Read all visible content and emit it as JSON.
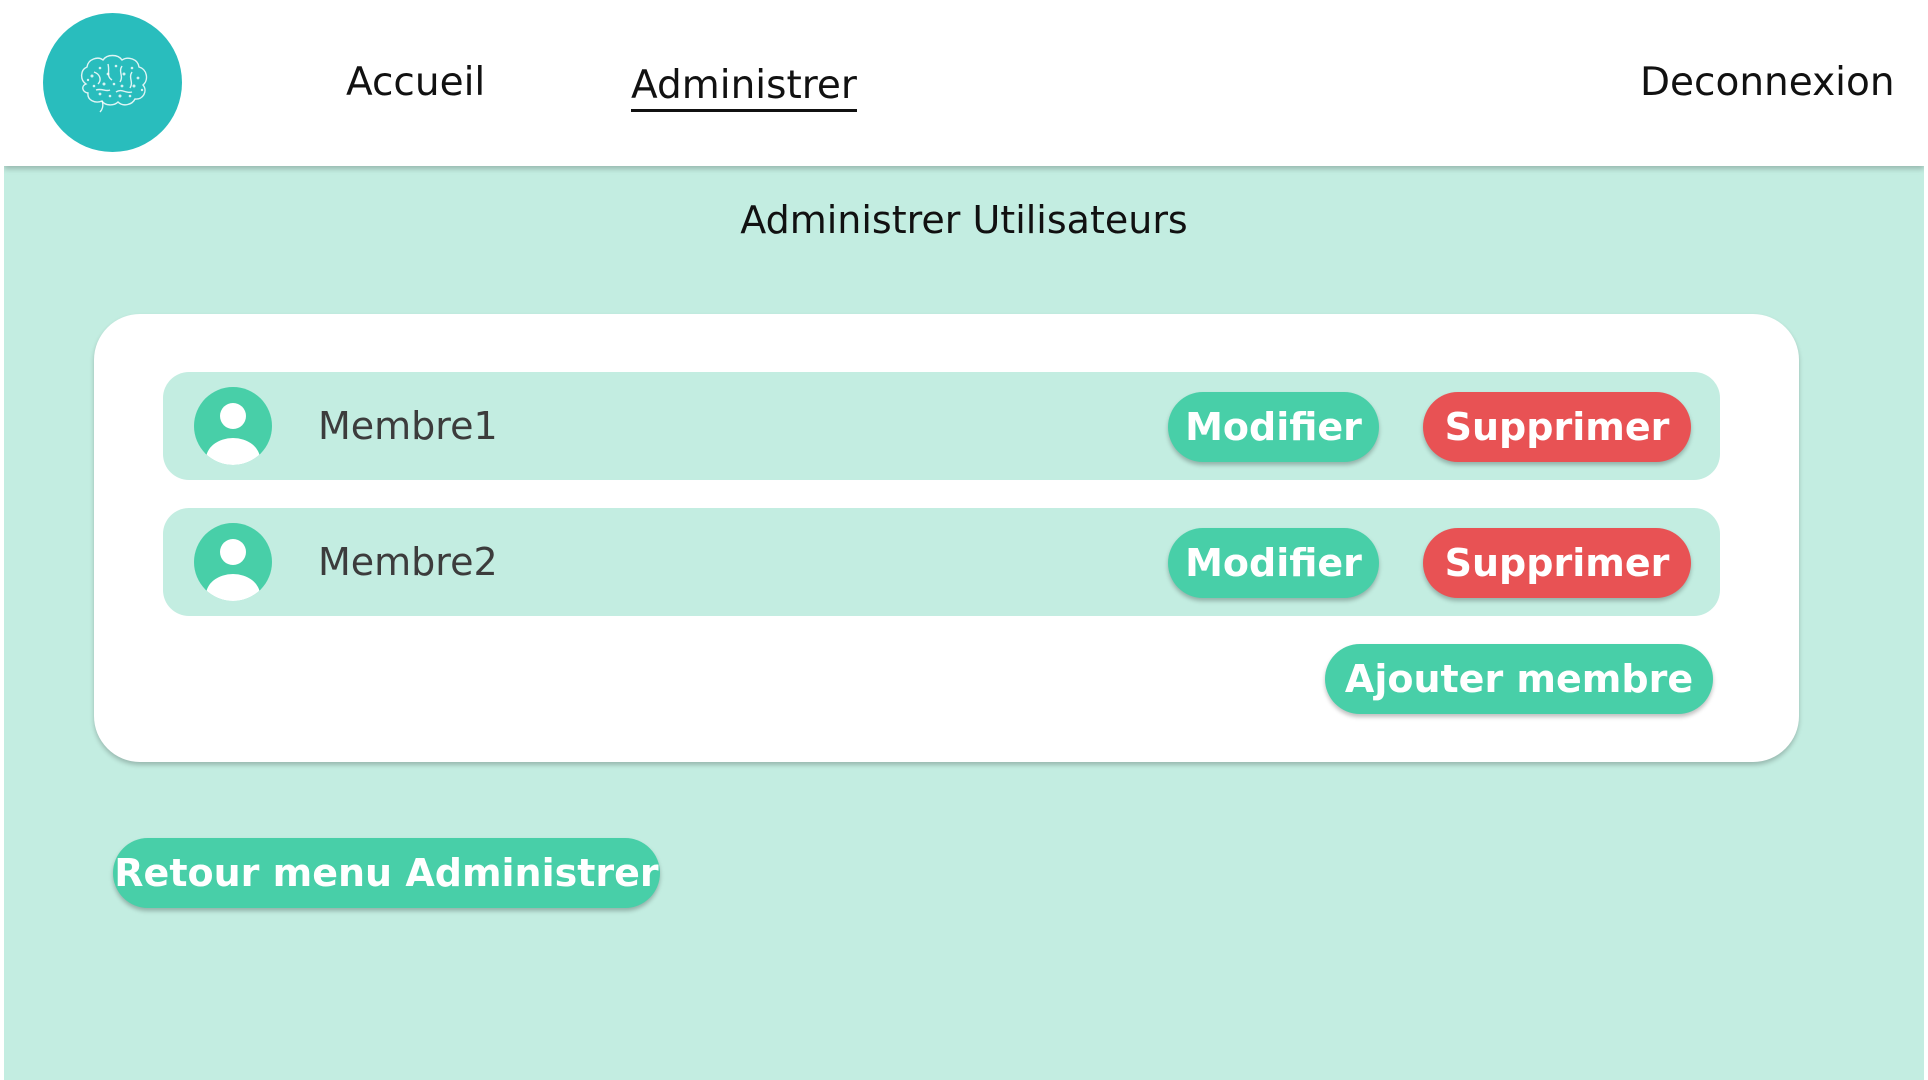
{
  "nav": {
    "home_label": "Accueil",
    "admin_label": "Administrer",
    "logout_label": "Deconnexion"
  },
  "page": {
    "title": "Administrer Utilisateurs"
  },
  "members": [
    {
      "name": "Membre1",
      "modify_label": "Modifier",
      "delete_label": "Supprimer"
    },
    {
      "name": "Membre2",
      "modify_label": "Modifier",
      "delete_label": "Supprimer"
    }
  ],
  "actions": {
    "add_member_label": "Ajouter membre",
    "back_label": "Retour menu Administrer"
  },
  "icons": {
    "logo": "brain-icon",
    "avatar": "user-avatar-icon"
  },
  "colors": {
    "background": "#c3ede1",
    "logo": "#29bdbd",
    "primary_button": "#48cfa8",
    "danger_button": "#e85254"
  }
}
